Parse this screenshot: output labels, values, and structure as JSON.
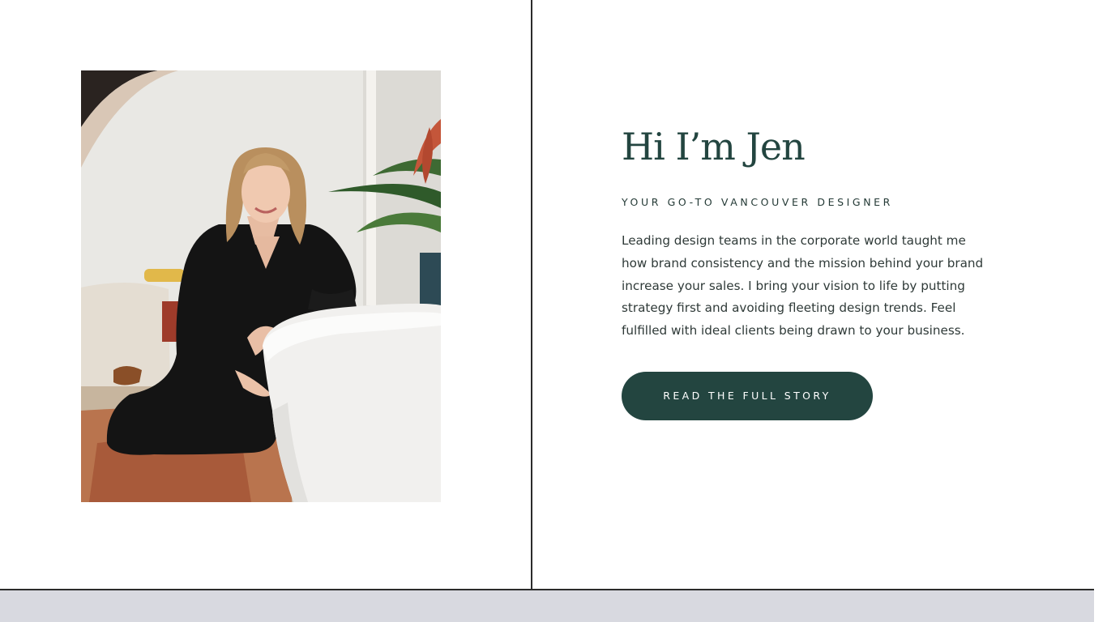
{
  "about": {
    "heading": "Hi I’m Jen",
    "subheading": "YOUR GO-TO VANCOUVER DESIGNER",
    "bio": "Leading design teams in the corporate world taught me how brand consistency and the mission behind your brand increase your sales. I bring your vision to life by putting strategy first and avoiding fleeting design trends. Feel fulfilled with ideal clients being drawn to your business.",
    "cta_label": "READ THE FULL STORY"
  },
  "colors": {
    "accent": "#234540",
    "divider": "#2b2b2b",
    "footer_band": "#d8d9e0",
    "background": "#ffffff"
  }
}
